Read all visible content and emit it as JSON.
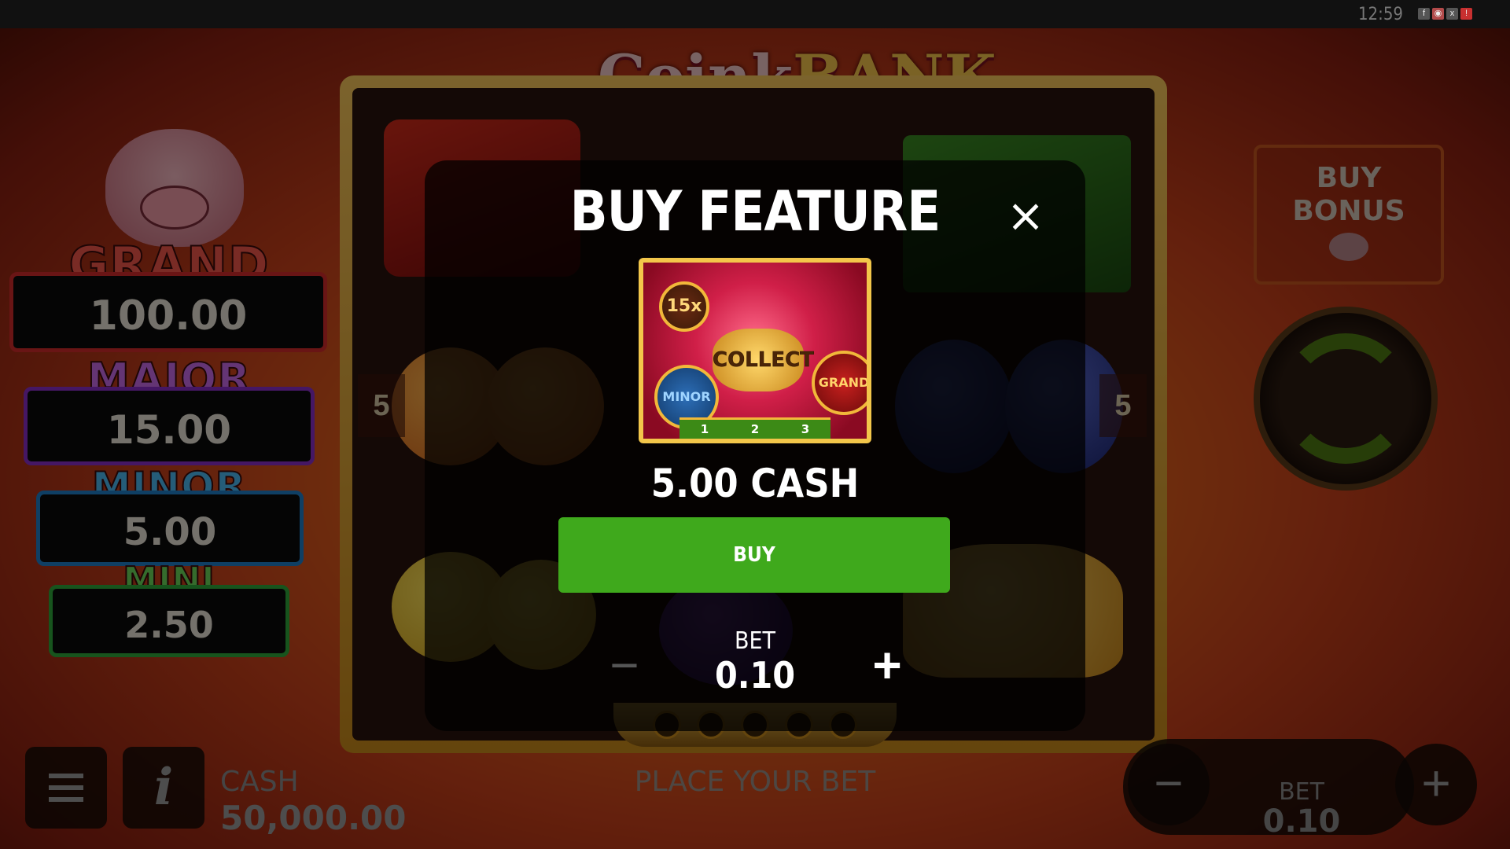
{
  "status_bar": {
    "time": "12:59",
    "icons": [
      "facebook-icon",
      "messenger-icon",
      "x-icon",
      "notification-icon"
    ]
  },
  "game": {
    "logo_part1": "Coink",
    "logo_part2": "BANK",
    "reel_line_left": "5",
    "reel_line_right": "5"
  },
  "jackpots": [
    {
      "name": "GRAND",
      "value": "100.00",
      "color": "#d32a2a"
    },
    {
      "name": "MAJOR",
      "value": "15.00",
      "color": "#8a2fc8"
    },
    {
      "name": "MINOR",
      "value": "5.00",
      "color": "#1e7fc8"
    },
    {
      "name": "MINI",
      "value": "2.50",
      "color": "#2ea83a"
    }
  ],
  "side_controls": {
    "buy_bonus_line1": "BUY",
    "buy_bonus_line2": "BONUS"
  },
  "bottom_bar": {
    "cash_label": "CASH",
    "cash_value": "50,000.00",
    "status_text": "PLACE YOUR BET",
    "bet_label": "BET",
    "bet_value": "0.10",
    "minus": "−",
    "plus": "+"
  },
  "modal": {
    "title": "BUY FEATURE",
    "close": "×",
    "feature_image_labels": {
      "collect": "COLLECT",
      "multiplier": "15x",
      "minor": "MINOR",
      "grand": "GRAND",
      "steps": [
        "1",
        "2",
        "3"
      ]
    },
    "price": "5.00 CASH",
    "buy_label": "BUY",
    "bet_label": "BET",
    "bet_value": "0.10",
    "minus": "−",
    "plus": "+"
  }
}
